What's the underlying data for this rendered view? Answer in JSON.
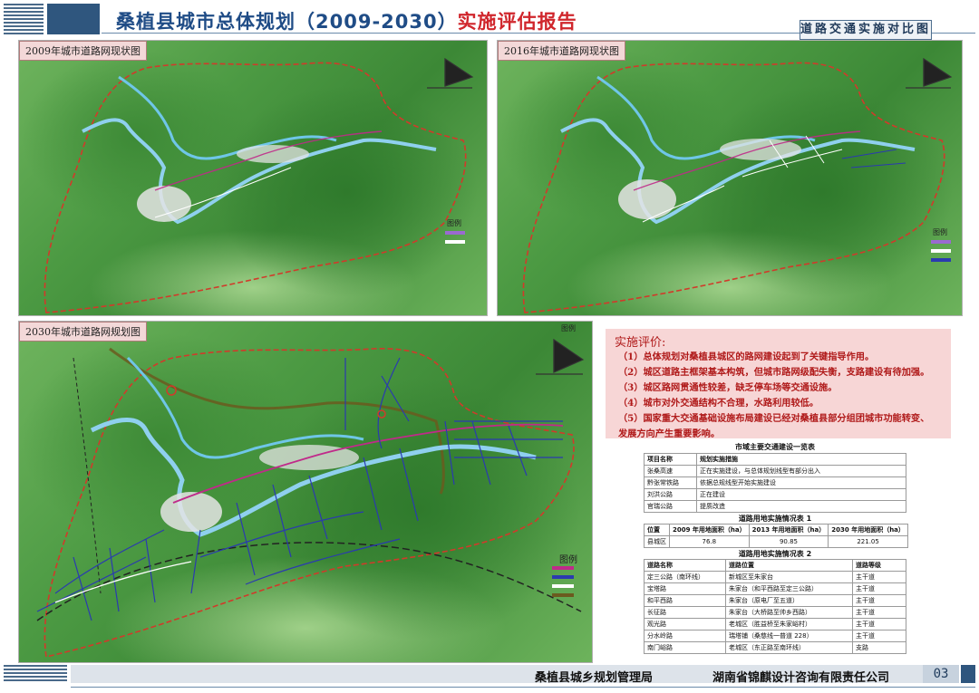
{
  "header": {
    "title_main": "桑植县城市总体规划（2009-2030）",
    "title_red": "实施评估报告",
    "tag": "道路交通实施对比图"
  },
  "maps": {
    "map2009": {
      "title": "2009年城市道路网现状图",
      "legend": "图例"
    },
    "map2016": {
      "title": "2016年城市道路网现状图",
      "legend": "图例"
    },
    "map2030": {
      "title": "2030年城市道路网规划图",
      "legend": "图例",
      "legend_small": "图例"
    }
  },
  "evaluation": {
    "title": "实施评价:",
    "items": [
      "（1）总体规划对桑植县城区的路网建设起到了关键指导作用。",
      "（2）城区道路主框架基本构筑，但城市路网级配失衡，支路建设有待加强。",
      "（3）城区路网贯通性较差，缺乏停车场等交通设施。",
      "（4）城市对外交通结构不合理，水路利用较低。",
      "（5）国家重大交通基础设施布局建设已经对桑植县部分组团城市功能转变、",
      "发展方向产生重要影响。"
    ]
  },
  "table1": {
    "caption": "市域主要交通建设一览表",
    "headers": [
      "项目名称",
      "规划实施措施"
    ],
    "rows": [
      [
        "张桑高速",
        "正在实施建设，与总体规划线型有部分出入"
      ],
      [
        "黔张常铁路",
        "依据总规线型开始实施建设"
      ],
      [
        "刘洪公路",
        "正在建设"
      ],
      [
        "官瑞公路",
        "提质改造"
      ]
    ]
  },
  "table2": {
    "caption": "道路用地实施情况表 1",
    "headers": [
      "位置",
      "2009 年用地面积（ha）",
      "2013 年用地面积（ha）",
      "2030 年用地面积（ha）"
    ],
    "rows": [
      [
        "县城区",
        "76.8",
        "90.85",
        "221.05"
      ]
    ]
  },
  "table3": {
    "caption": "道路用地实施情况表 2",
    "headers": [
      "道路名称",
      "道路位置",
      "道路等级"
    ],
    "rows": [
      [
        "定三公路（南环线）",
        "新城区至朱家台",
        "主干道"
      ],
      [
        "宝塔路",
        "朱家台（和平西路至定三公路）",
        "主干道"
      ],
      [
        "和平西路",
        "朱家台（原电厂至五道）",
        "主干道"
      ],
      [
        "长征路",
        "朱家台（大桥路至帅乡西路）",
        "主干道"
      ],
      [
        "观光路",
        "老城区（胜益桥至朱家峪村）",
        "主干道"
      ],
      [
        "分水岭路",
        "瑞塔铺（桑慈线一普道 228）",
        "主干道"
      ],
      [
        "南门峪路",
        "老城区（东正路至南环线）",
        "支路"
      ]
    ]
  },
  "footer": {
    "agency": "桑植县城乡规划管理局",
    "company": "湖南省锦麒设计咨询有限责任公司",
    "page": "03"
  },
  "colors": {
    "title_blue": "#1f4c86",
    "title_red": "#d0262c",
    "eval_text": "#b01a1a",
    "eval_bg": "#f7d6d6",
    "boundary": "#d13a2a",
    "river": "#6fc6e8"
  }
}
